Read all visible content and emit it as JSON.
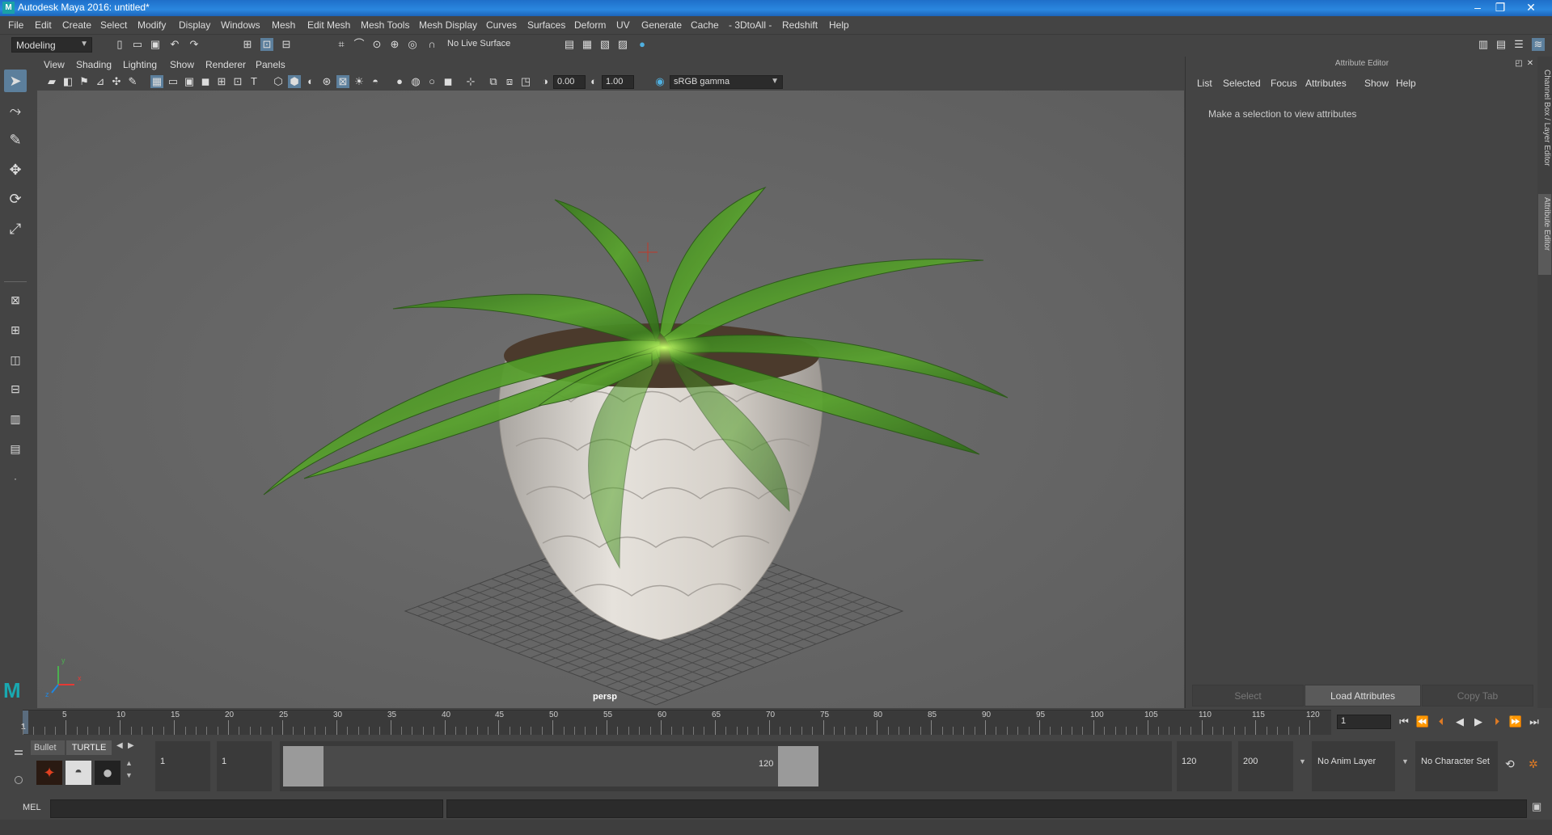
{
  "window": {
    "title": "Autodesk Maya 2016: untitled*",
    "logo": "M",
    "buttons": [
      "–",
      "❐",
      "✕"
    ]
  },
  "menubar": [
    "File",
    "Edit",
    "Create",
    "Select",
    "Modify",
    "Display",
    "Windows",
    "Mesh",
    "Edit Mesh",
    "Mesh Tools",
    "Mesh Display",
    "Curves",
    "Surfaces",
    "Deform",
    "UV",
    "Generate",
    "Cache",
    "- 3DtoAll -",
    "Redshift",
    "Help"
  ],
  "shelf": {
    "mode": "Modeling",
    "live_surface": "No Live Surface"
  },
  "viewport": {
    "menu": [
      "View",
      "Shading",
      "Lighting",
      "Show",
      "Renderer",
      "Panels"
    ],
    "exposure": "0.00",
    "gamma": "1.00",
    "color_space": "sRGB gamma",
    "camera_label": "persp",
    "axes": {
      "x": "x",
      "y": "y",
      "z": "z"
    }
  },
  "attribute_editor": {
    "title": "Attribute Editor",
    "menu": [
      "List",
      "Selected",
      "Focus",
      "Attributes",
      "Show",
      "Help"
    ],
    "message": "Make a selection to view attributes",
    "buttons": {
      "select": "Select",
      "load": "Load Attributes",
      "copy_tab": "Copy Tab"
    }
  },
  "side_tabs": {
    "channel_box": "Channel Box / Layer Editor",
    "attribute_editor": "Attribute Editor"
  },
  "timeslider": {
    "current_marker": "1",
    "ticks": [
      "5",
      "10",
      "15",
      "20",
      "25",
      "30",
      "35",
      "40",
      "45",
      "50",
      "55",
      "60",
      "65",
      "70",
      "75",
      "80",
      "85",
      "90",
      "95",
      "100",
      "105",
      "110",
      "115",
      "120"
    ],
    "current_frame": "1"
  },
  "shelf_tabs": {
    "bullet": "Bullet",
    "turtle": "TURTLE"
  },
  "range": {
    "start": "1",
    "playback_start": "1",
    "range_start_label": "1",
    "range_end_label": "120",
    "playback_end": "120",
    "end": "200",
    "anim_layer": "No Anim Layer",
    "character_set": "No Character Set"
  },
  "command_line": {
    "label": "MEL"
  },
  "colors": {
    "accent": "#5c7f9c",
    "titlebar": "#2a87df",
    "leaf": "#4f9a2a",
    "pot": "#d8d4cf"
  }
}
